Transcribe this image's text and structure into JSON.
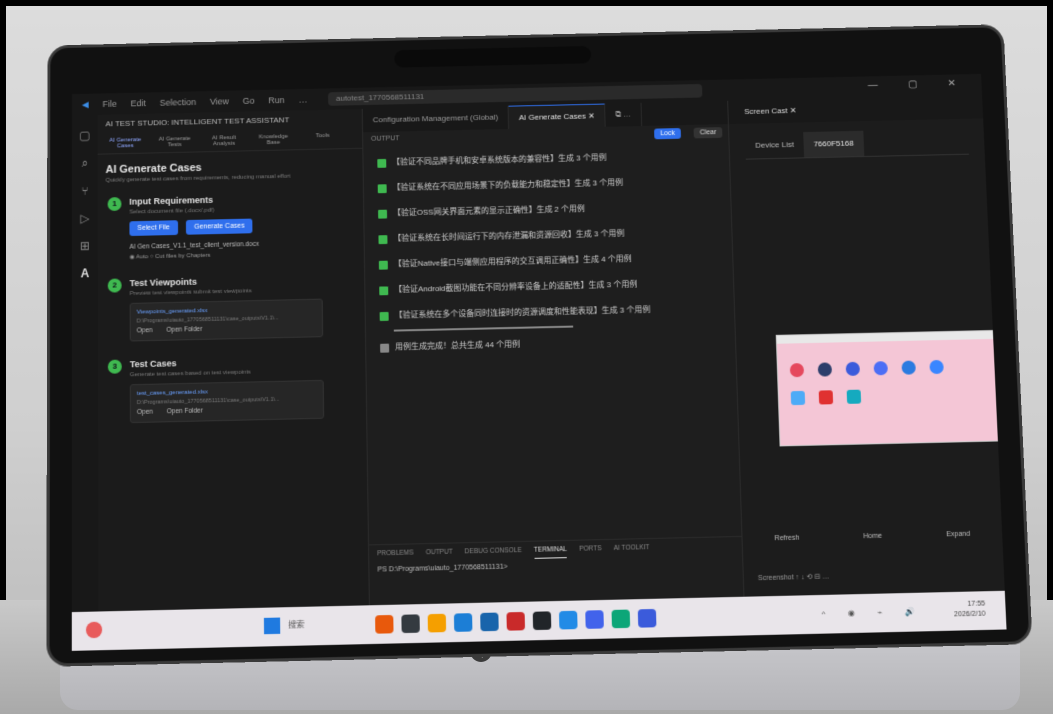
{
  "window": {
    "menu": [
      "File",
      "Edit",
      "Selection",
      "View",
      "Go",
      "Run",
      "…"
    ],
    "search_text": "autotest_1770568511131",
    "controls": "— ▢ ✕"
  },
  "side": {
    "header": "AI TEST STUDIO: INTELLIGENT TEST ASSISTANT",
    "tabs": [
      "AI Generate Cases",
      "AI Generate Tests",
      "AI Result Analysis",
      "Knowledge Base",
      "Tools"
    ],
    "title": "AI Generate Cases",
    "subtitle": "Quickly generate test cases from requirements, reducing manual effort",
    "step1": {
      "num": "1",
      "title": "Input Requirements",
      "desc": "Select document file (.docx/.pdf)",
      "select_btn": "Select File",
      "generate_btn": "Generate Cases",
      "file_line": "AI Gen Cases_V1.1_test_client_version.docx",
      "options": "◉ Auto  ○ Cut files by Chapters"
    },
    "step2": {
      "num": "2",
      "title": "Test Viewpoints",
      "desc": "Preview test viewpoints submit test viewpoints",
      "file": "Viewpoints_generated.xlsx",
      "path": "D:\\Programs\\uiauto_1770568511131\\case_outputs\\V1.1\\...",
      "open": "Open",
      "open_folder": "Open Folder"
    },
    "step3": {
      "num": "3",
      "title": "Test Cases",
      "desc": "Generate test cases based on test viewpoints",
      "file": "test_cases_generated.xlsx",
      "path": "D:\\Programs\\uiauto_1770568511131\\case_outputs\\V1.1\\...",
      "open": "Open",
      "open_folder": "Open Folder"
    }
  },
  "editor": {
    "tabs": [
      "Configuration Management (Global)",
      "AI Generate Cases ✕",
      "⧉ …"
    ],
    "output_label": "OUTPUT",
    "lock_btn": "Lock",
    "clear_btn": "Clear",
    "logs": [
      "【验证不同品牌手机和安卓系统版本的兼容性】生成 3 个用例",
      "【验证系统在不同应用场景下的负载能力和稳定性】生成 3 个用例",
      "【验证OSS网关界面元素的显示正确性】生成 2 个用例",
      "【验证系统在长时间运行下的内存泄漏和资源回收】生成 3 个用例",
      "【验证Native接口与端侧应用程序的交互调用正确性】生成 4 个用例",
      "【验证Android截图功能在不同分辨率设备上的适配性】生成 3 个用例",
      "【验证系统在多个设备同时连接时的资源调度和性能表现】生成 3 个用例"
    ],
    "summary": "用例生成完成！总共生成 44 个用例",
    "panel_tabs": [
      "PROBLEMS",
      "OUTPUT",
      "DEBUG CONSOLE",
      "TERMINAL",
      "PORTS",
      "AI TOOLKIT"
    ],
    "terminal_line": "PS D:\\Programs\\uiauto_1770568511131>"
  },
  "right": {
    "tab": "Screen Cast ✕",
    "device_list": "Device List",
    "device_id": "7660F5168",
    "ctrl": [
      "Refresh",
      "Home",
      "Expand"
    ],
    "screenshot": "Screenshot ↑ ↓ ⟲ ⊟ …"
  },
  "taskbar": {
    "search": "搜索",
    "clock_time": "17:55",
    "clock_date": "2026/2/10"
  },
  "colors": {
    "accent": "#2f6fed",
    "success": "#3fb950",
    "bg": "#1e1e1e"
  }
}
